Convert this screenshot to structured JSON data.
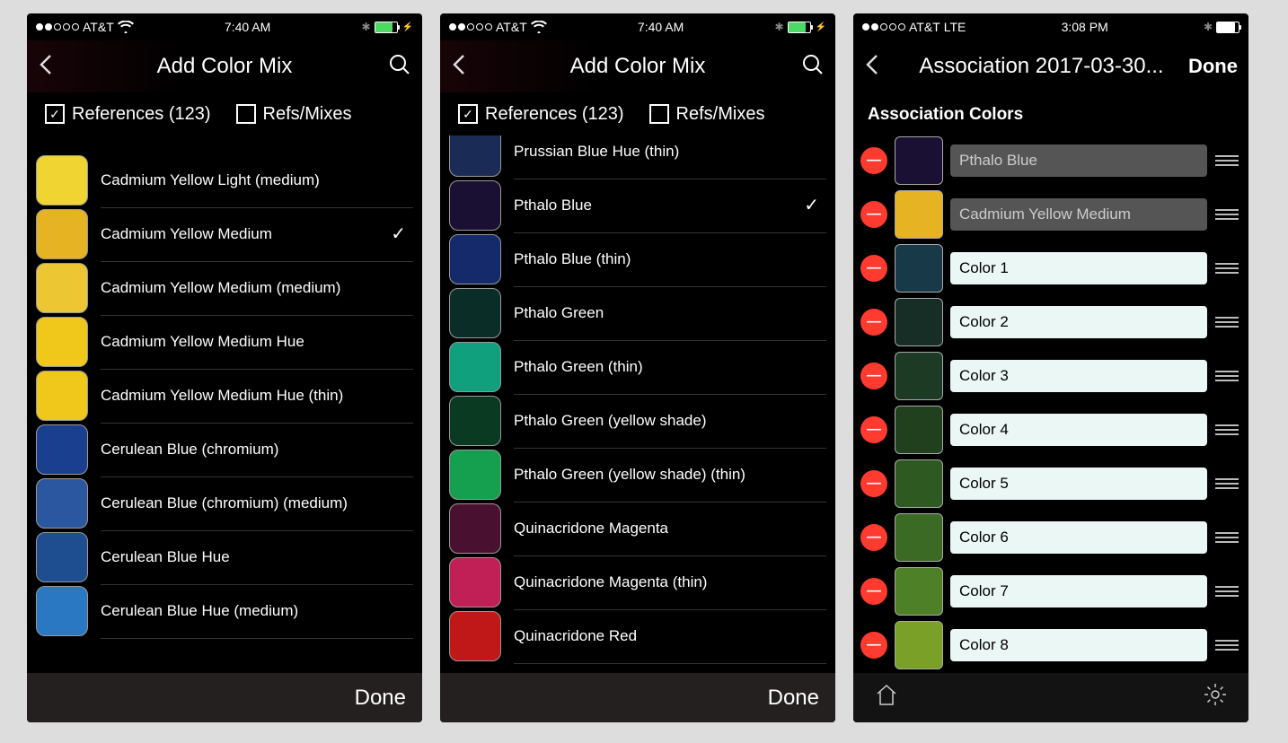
{
  "screens": [
    {
      "status": {
        "carrier": "AT&T",
        "time": "7:40 AM",
        "lte": false,
        "wifi": true,
        "batteryColor": "green",
        "bolt": true
      },
      "header": {
        "title": "Add Color Mix",
        "search": true,
        "done": false
      },
      "filter": {
        "show": true,
        "references_label": "References (123)",
        "references_checked": true,
        "refsmixes_label": "Refs/Mixes",
        "refsmixes_checked": false
      },
      "list": [
        {
          "name": "Cadmium Yellow Light (medium)",
          "color": "#f0d431",
          "checked": false
        },
        {
          "name": "Cadmium Yellow Medium",
          "color": "#e6b423",
          "checked": true
        },
        {
          "name": "Cadmium Yellow Medium (medium)",
          "color": "#ecc733",
          "checked": false
        },
        {
          "name": "Cadmium Yellow Medium Hue",
          "color": "#f0c81b",
          "checked": false
        },
        {
          "name": "Cadmium Yellow Medium Hue (thin)",
          "color": "#f0c71b",
          "checked": false
        },
        {
          "name": "Cerulean Blue (chromium)",
          "color": "#1b3f8f",
          "checked": false
        },
        {
          "name": "Cerulean Blue (chromium) (medium)",
          "color": "#2a57a0",
          "checked": false
        },
        {
          "name": "Cerulean Blue Hue",
          "color": "#1e4e8f",
          "checked": false
        },
        {
          "name": "Cerulean Blue Hue (medium)",
          "color": "#2a78c2",
          "checked": false
        }
      ],
      "footer": {
        "type": "done",
        "label": "Done"
      }
    },
    {
      "status": {
        "carrier": "AT&T",
        "time": "7:40 AM",
        "lte": false,
        "wifi": true,
        "batteryColor": "green",
        "bolt": true
      },
      "header": {
        "title": "Add Color Mix",
        "search": true,
        "done": false
      },
      "filter": {
        "show": true,
        "references_label": "References (123)",
        "references_checked": true,
        "refsmixes_label": "Refs/Mixes",
        "refsmixes_checked": false
      },
      "list": [
        {
          "name": "Prussian Blue Hue (thin)",
          "color": "#1a2c55",
          "checked": false,
          "partial": true
        },
        {
          "name": "Pthalo Blue",
          "color": "#1a1033",
          "checked": true
        },
        {
          "name": "Pthalo Blue (thin)",
          "color": "#152a6a",
          "checked": false
        },
        {
          "name": "Pthalo Green",
          "color": "#0a2d28",
          "checked": false
        },
        {
          "name": "Pthalo Green (thin)",
          "color": "#10a07e",
          "checked": false
        },
        {
          "name": "Pthalo Green (yellow shade)",
          "color": "#0b3a22",
          "checked": false
        },
        {
          "name": "Pthalo Green (yellow shade) (thin)",
          "color": "#15a050",
          "checked": false
        },
        {
          "name": "Quinacridone Magenta",
          "color": "#4a1030",
          "checked": false
        },
        {
          "name": "Quinacridone Magenta (thin)",
          "color": "#c02055",
          "checked": false
        },
        {
          "name": "Quinacridone Red",
          "color": "#c01818",
          "checked": false,
          "partialBottom": true
        }
      ],
      "footer": {
        "type": "done",
        "label": "Done"
      }
    },
    {
      "status": {
        "carrier": "AT&T",
        "time": "3:08 PM",
        "lte": true,
        "wifi": false,
        "batteryColor": "white",
        "bolt": false
      },
      "header": {
        "title": "Association 2017-03-30...",
        "search": false,
        "done": true,
        "done_label": "Done"
      },
      "filter": {
        "show": false
      },
      "section_title": "Association Colors",
      "assoc": [
        {
          "name": "Pthalo Blue",
          "color": "#1a1033",
          "readonly": true
        },
        {
          "name": "Cadmium Yellow Medium",
          "color": "#e6b423",
          "readonly": true
        },
        {
          "name": "Color 1",
          "color": "#183a48",
          "readonly": false
        },
        {
          "name": "Color 2",
          "color": "#172e27",
          "readonly": false
        },
        {
          "name": "Color 3",
          "color": "#1d3a24",
          "readonly": false
        },
        {
          "name": "Color 4",
          "color": "#20401e",
          "readonly": false
        },
        {
          "name": "Color 5",
          "color": "#2e5a22",
          "readonly": false
        },
        {
          "name": "Color 6",
          "color": "#3a6a24",
          "readonly": false
        },
        {
          "name": "Color 7",
          "color": "#4e8028",
          "readonly": false
        },
        {
          "name": "Color 8",
          "color": "#7aa028",
          "readonly": false
        }
      ],
      "footer": {
        "type": "tabs"
      }
    }
  ]
}
